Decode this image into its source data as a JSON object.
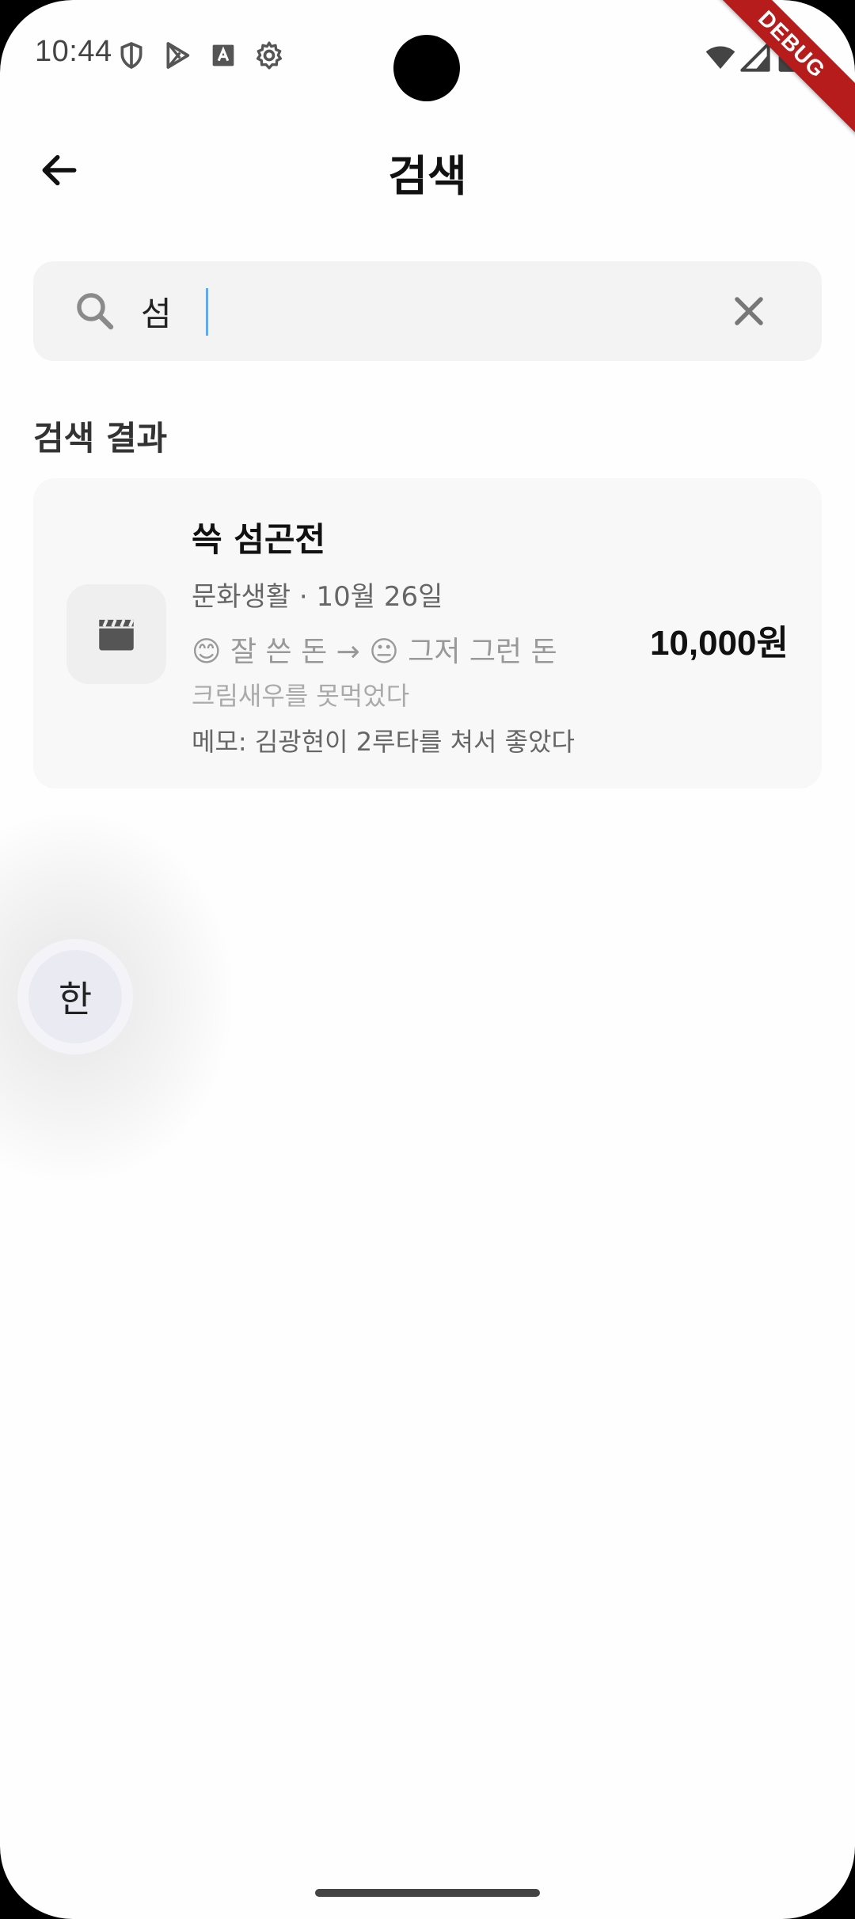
{
  "status_bar": {
    "time": "10:44",
    "icons": [
      "shield-icon",
      "play-store-icon",
      "keyboard-a-icon",
      "gear-icon"
    ],
    "right_icons": [
      "wifi-icon",
      "signal-icon",
      "battery-icon"
    ],
    "debug_label": "DEBUG"
  },
  "header": {
    "title": "검색",
    "back_icon": "arrow-left-icon"
  },
  "search": {
    "value": "섬",
    "placeholder": ""
  },
  "results": {
    "section_title": "검색 결과",
    "items": [
      {
        "title": "쓱 섬곤전",
        "meta": "문화생활 · 10월 26일",
        "rating": "😊 잘 쓴 돈 → 😐 그저 그런 돈",
        "description": "크림새우를 못먹었다",
        "memo": "메모: 김광현이 2루타를 쳐서 좋았다",
        "amount": "10,000원",
        "icon": "clapperboard-icon"
      }
    ]
  },
  "ime": {
    "label": "한"
  },
  "colors": {
    "background": "#fefefe",
    "card": "#f8f8f8",
    "search_bg": "#f3f3f3",
    "caret": "#64a8f0",
    "debug": "#b71c1c"
  }
}
